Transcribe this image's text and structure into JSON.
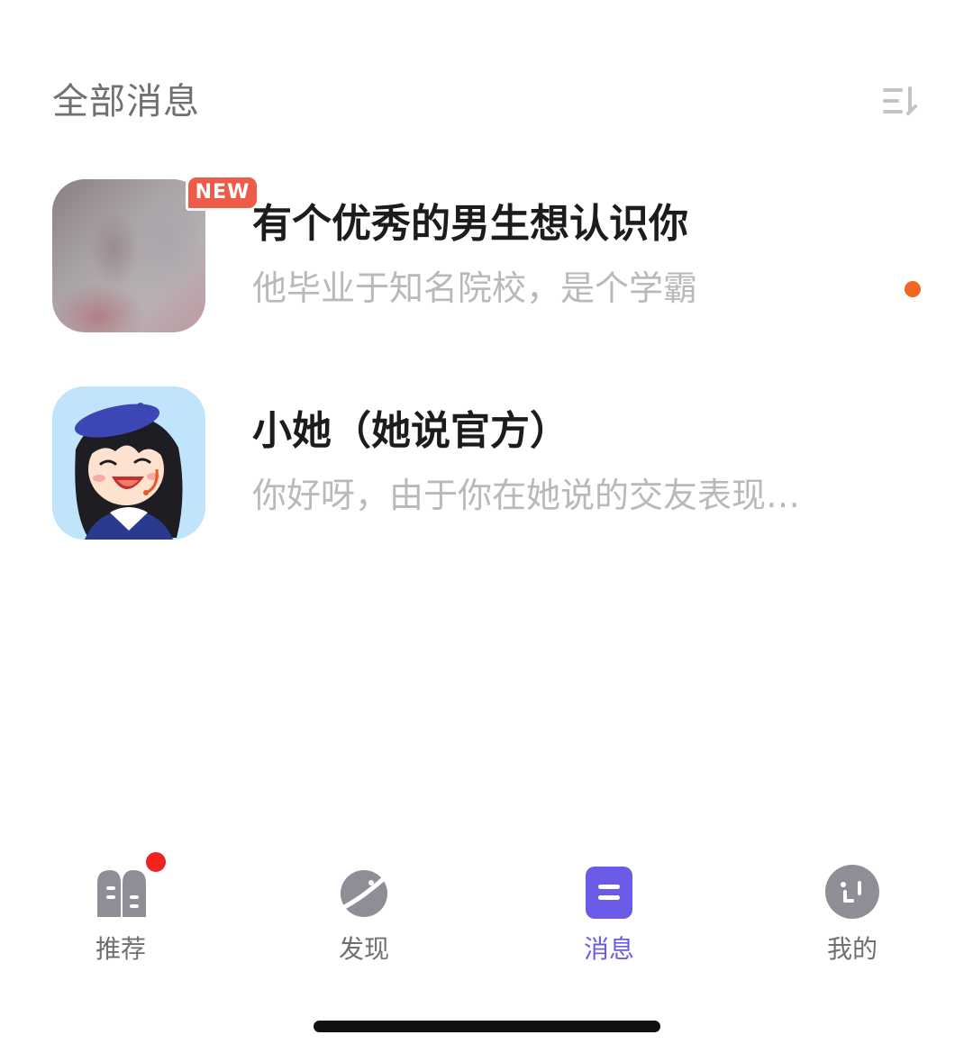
{
  "header": {
    "title": "全部消息",
    "sort_icon": "sort-list-icon"
  },
  "messages": [
    {
      "title": "有个优秀的男生想认识你",
      "preview": "他毕业于知名院校，是个学霸",
      "badge": "NEW",
      "unread": true,
      "avatar": "blurred-photo"
    },
    {
      "title": "小她（她说官方）",
      "preview": "你好呀，由于你在她说的交友表现…",
      "unread": false,
      "avatar": "cartoon-girl-beret"
    }
  ],
  "tabbar": {
    "items": [
      {
        "label": "推荐",
        "icon": "recommend-icon",
        "has_dot": true,
        "active": false
      },
      {
        "label": "发现",
        "icon": "planet-icon",
        "has_dot": false,
        "active": false
      },
      {
        "label": "消息",
        "icon": "message-icon",
        "has_dot": false,
        "active": true
      },
      {
        "label": "我的",
        "icon": "profile-face-icon",
        "has_dot": false,
        "active": false
      }
    ]
  },
  "colors": {
    "accent": "#6b5ce7",
    "unread_dot": "#f26522",
    "badge": "#ee5b48",
    "tab_dot": "#f02323",
    "inactive": "#8e8e96"
  }
}
